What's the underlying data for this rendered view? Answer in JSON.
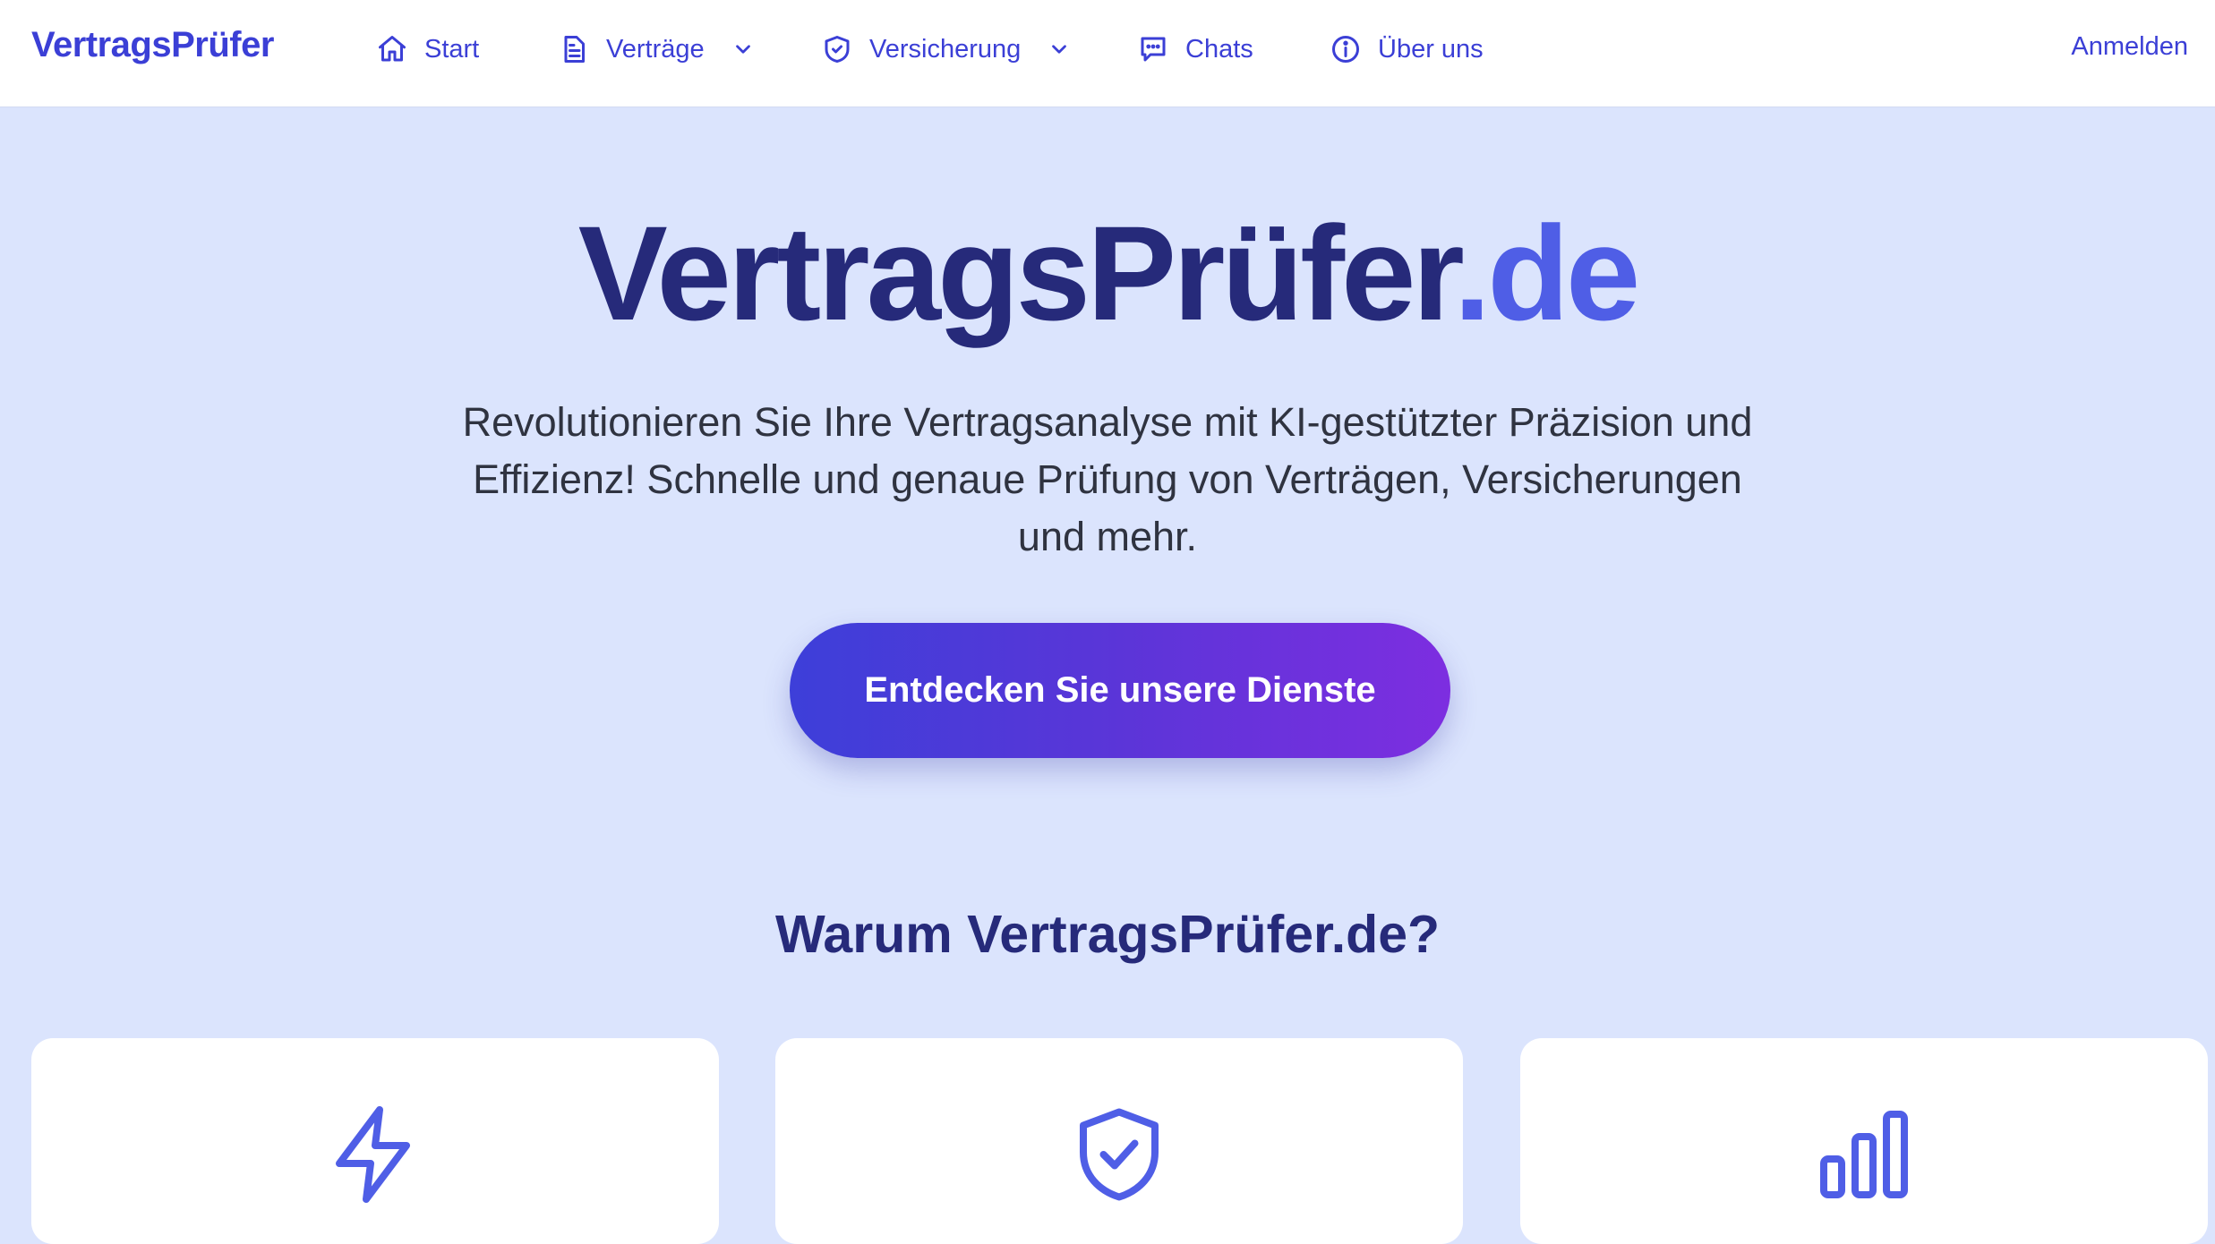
{
  "brand": "VertragsPrüfer",
  "nav": {
    "items": [
      {
        "label": "Start",
        "icon": "home-icon"
      },
      {
        "label": "Verträge",
        "icon": "document-icon",
        "dropdown": true
      },
      {
        "label": "Versicherung",
        "icon": "shield-icon",
        "dropdown": true
      },
      {
        "label": "Chats",
        "icon": "chat-icon"
      },
      {
        "label": "Über uns",
        "icon": "info-icon"
      }
    ],
    "login": "Anmelden"
  },
  "hero": {
    "title_main": "VertragsPrüfer",
    "title_accent": ".de",
    "subtitle": "Revolutionieren Sie Ihre Vertragsanalyse mit KI-gestützter Präzision und Effizienz! Schnelle und genaue Prüfung von Verträgen, Versicherungen und mehr.",
    "cta": "Entdecken Sie unsere Dienste"
  },
  "why": {
    "title": "Warum VertragsPrüfer.de?",
    "cards": [
      {
        "icon": "lightning-icon"
      },
      {
        "icon": "shield-check-icon"
      },
      {
        "icon": "bar-chart-icon"
      }
    ]
  },
  "colors": {
    "accent": "#3b3fd6",
    "dark": "#262a7a",
    "background": "#dbe4fd",
    "gradient_start": "#3d3fd9",
    "gradient_end": "#7d2ee0"
  }
}
